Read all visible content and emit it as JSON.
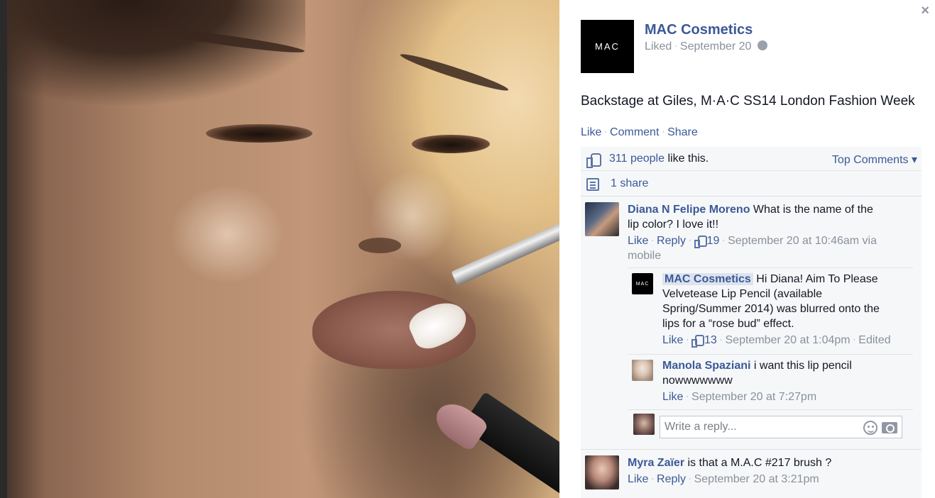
{
  "photo": {
    "alt": "Backstage makeup photo"
  },
  "close_label": "×",
  "page": {
    "logo_text": "MAC",
    "name": "MAC Cosmetics",
    "liked": "Liked",
    "date": "September 20"
  },
  "post": {
    "text": "Backstage at Giles, M·A·C SS14 London Fashion Week",
    "actions": {
      "like": "Like",
      "comment": "Comment",
      "share": "Share"
    }
  },
  "ufi": {
    "likes_count": "311 people",
    "likes_suffix": "like this.",
    "top_comments": "Top Comments ▾",
    "shares": "1 share"
  },
  "comments": [
    {
      "author": "Diana N Felipe Moreno",
      "text_line1": "What is the name of the",
      "text_line2": "lip color? I love it!!",
      "like": "Like",
      "reply": "Reply",
      "likes": "19",
      "time_line1": "September 20 at 10:46am via",
      "time_line2": "mobile",
      "replies": [
        {
          "author": "MAC Cosmetics",
          "text_line1": "Hi Diana! Aim To Please",
          "text_line2": "Velvetease Lip Pencil (available",
          "text_line3": "Spring/Summer 2014) was blurred onto the",
          "text_line4": "lips for a “rose bud” effect.",
          "like": "Like",
          "likes": "13",
          "time": "September 20 at 1:04pm",
          "edited": "Edited"
        },
        {
          "author": "Manola Spaziani",
          "text_line1": "i want this lip pencil",
          "text_line2": "nowwwwwww",
          "like": "Like",
          "time": "September 20 at 7:27pm"
        }
      ],
      "reply_placeholder": "Write a reply..."
    },
    {
      "author": "Myra Zaïer",
      "text": "is that a M.A.C #217 brush ?",
      "like": "Like",
      "reply": "Reply",
      "time": "September 20 at 3:21pm"
    }
  ]
}
